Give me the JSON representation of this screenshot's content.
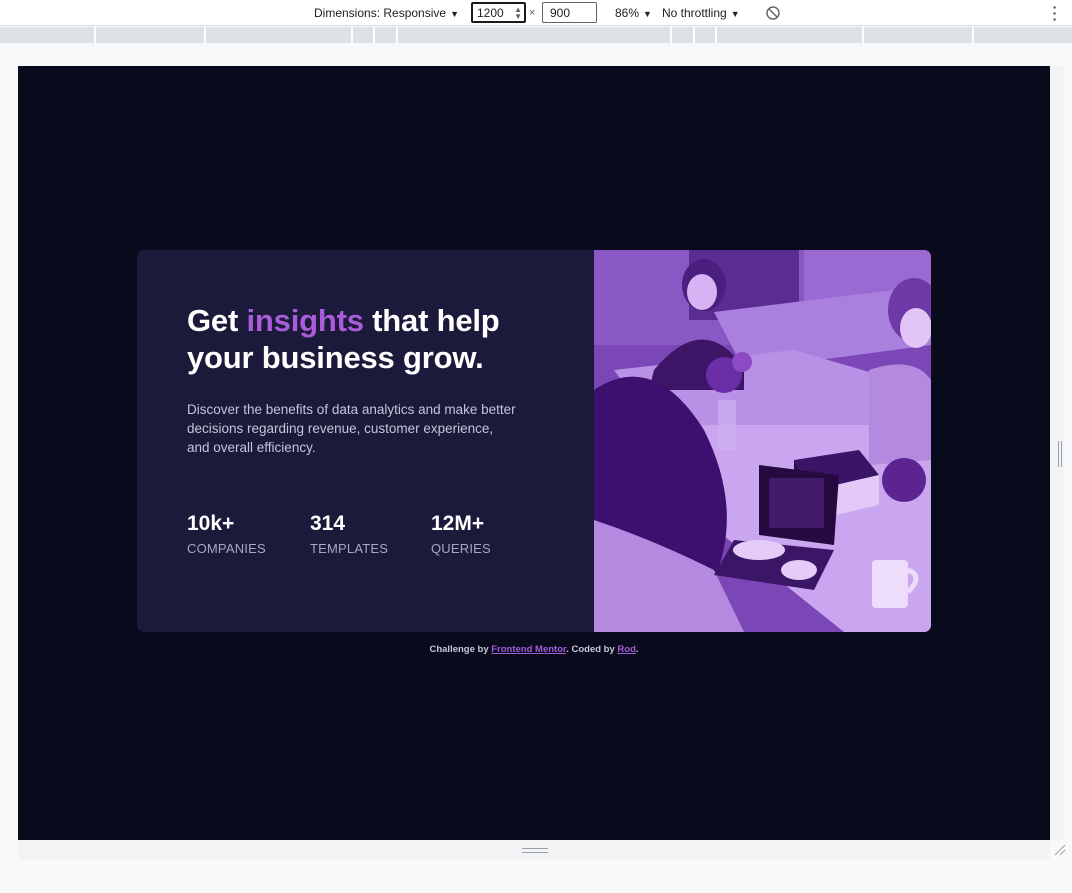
{
  "devtools": {
    "dimensions_label": "Dimensions: Responsive",
    "width_value": "1200",
    "times_sign": "×",
    "height_value": "900",
    "zoom_value": "86%",
    "throttling_value": "No throttling",
    "rotate_icon": "rotate-icon",
    "more_icon": "more-vertical-icon"
  },
  "card": {
    "headline": {
      "before": "Get ",
      "accent": "insights",
      "after": " that help your business grow."
    },
    "description": "Discover the benefits of data analytics and make better decisions regarding revenue, customer experience, and overall efficiency.",
    "stats": [
      {
        "value": "10k+",
        "label": "COMPANIES"
      },
      {
        "value": "314",
        "label": "TEMPLATES"
      },
      {
        "value": "12M+",
        "label": "QUERIES"
      }
    ],
    "image_desc": "photo of people working at a table with laptops, purple overlay"
  },
  "footer": {
    "prefix": "Challenge by ",
    "link1": "Frontend Mentor",
    "middle": ". Coded by ",
    "link2": "Rod",
    "suffix": "."
  },
  "colors": {
    "page_bg": "#090b1c",
    "card_bg": "#1c1a3a",
    "accent": "#aa5cdb",
    "image_overlay": "#7a45b5"
  }
}
